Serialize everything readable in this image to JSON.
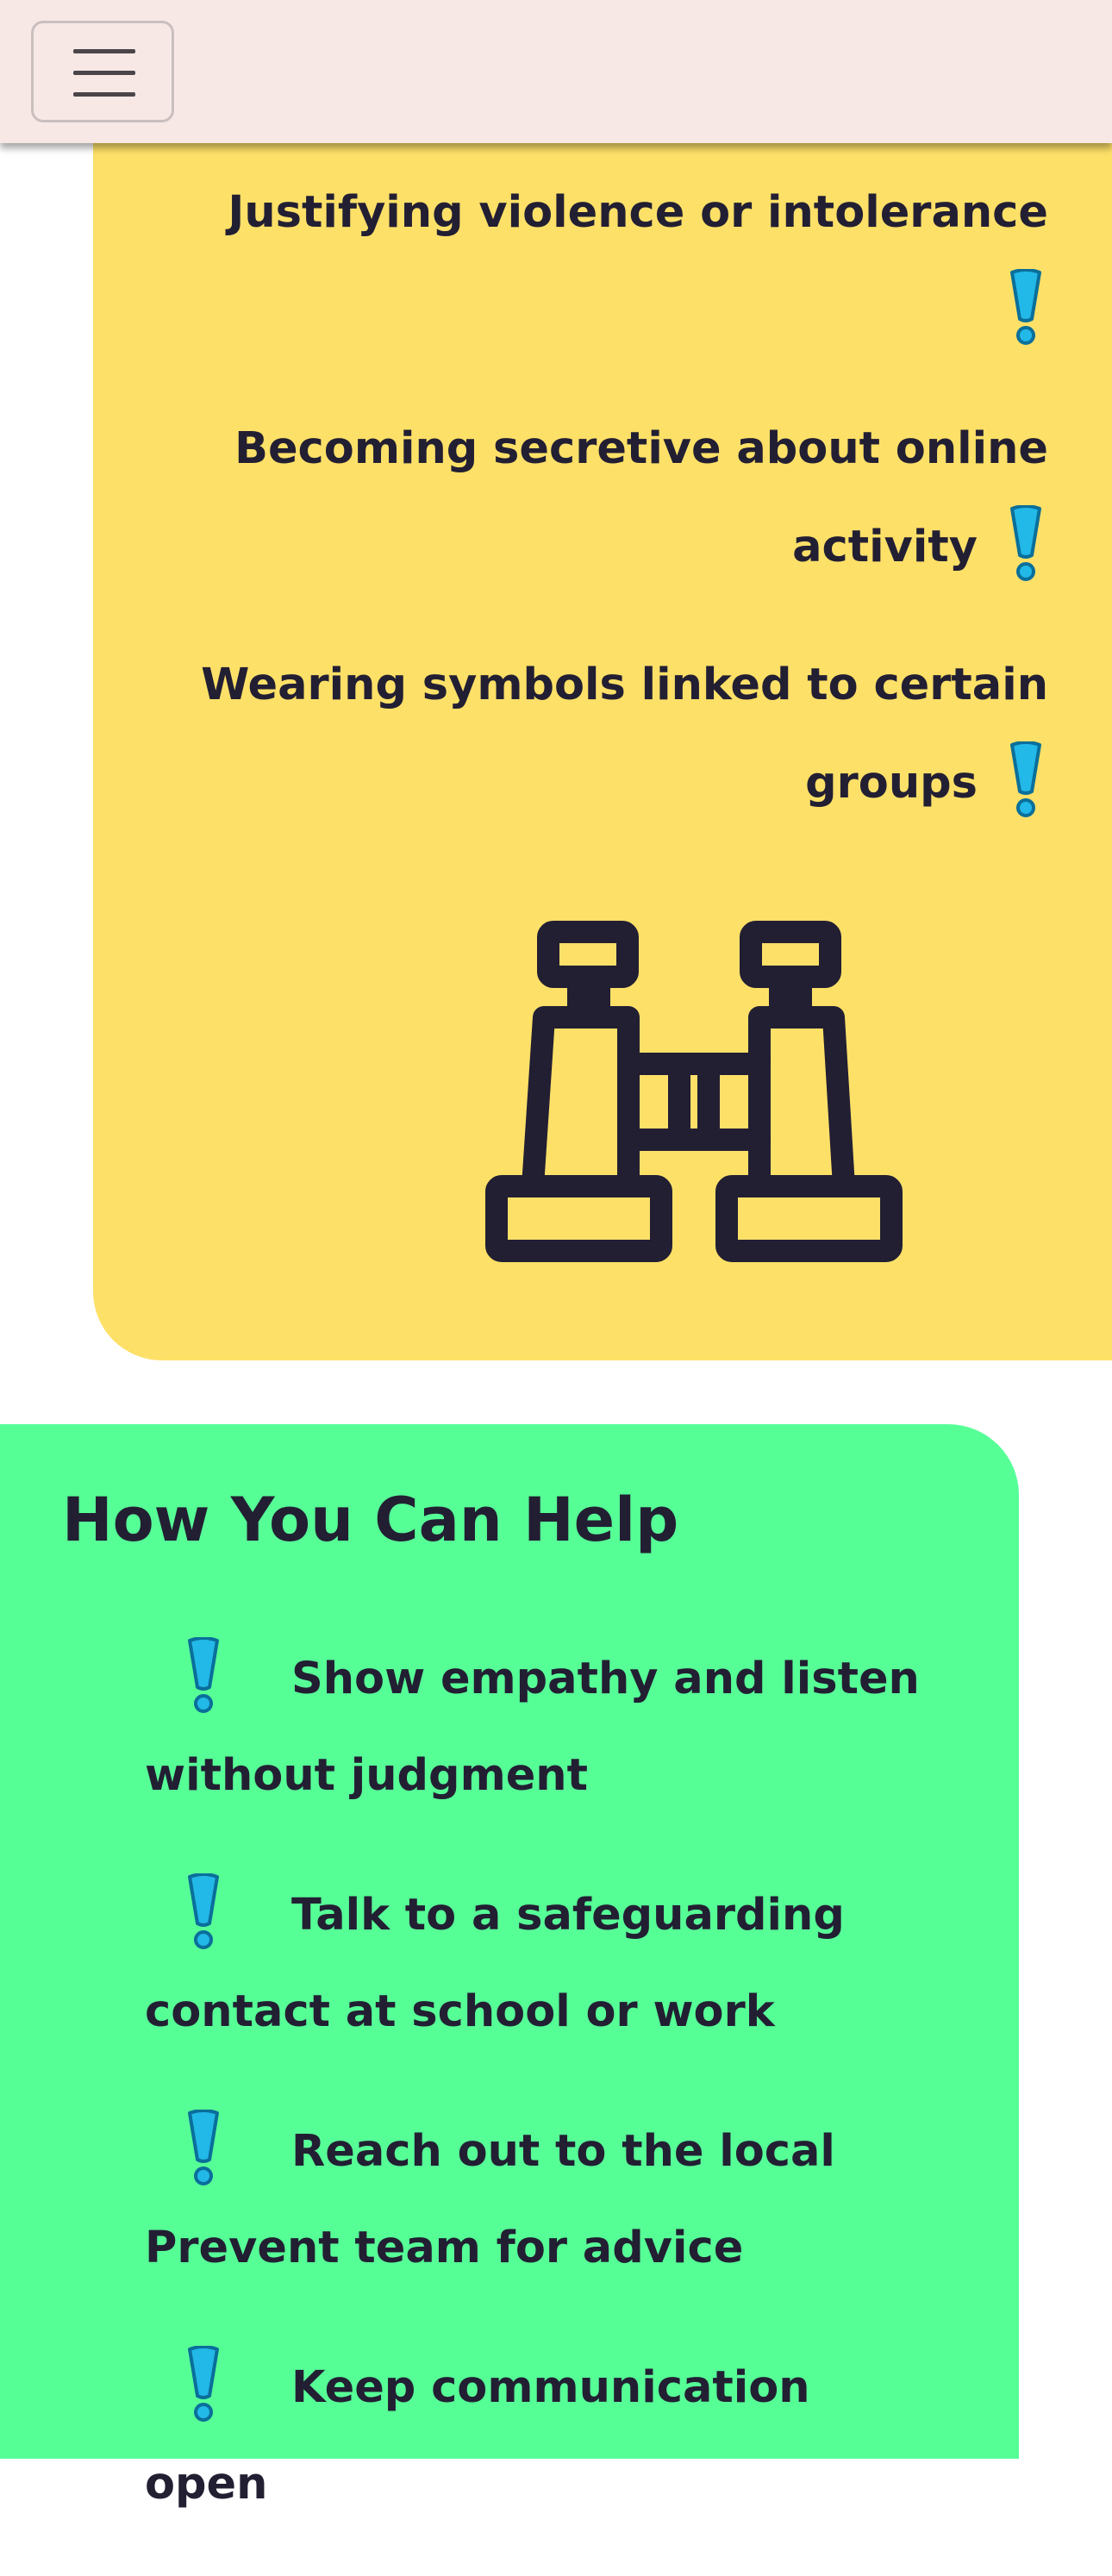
{
  "header": {
    "menu_icon": "hamburger-menu-icon"
  },
  "warning_signs": {
    "items": [
      "Justifying violence or intolerance",
      "Becoming secretive about online activity",
      "Wearing symbols linked to certain groups"
    ],
    "item_icon": "exclamation-icon",
    "illustration": "binoculars-icon",
    "background_color": "#fde068"
  },
  "help": {
    "title": "How You Can Help",
    "items": [
      "Show empathy and listen without judgment",
      "Talk to a safeguarding contact at school or work",
      "Reach out to the local Prevent team for advice",
      "Keep communication open"
    ],
    "item_icon": "exclamation-icon",
    "background_color": "#57ff97"
  },
  "colors": {
    "exclamation": "#1aa8d8",
    "text": "#221f33",
    "header_bg": "#f7e8e6"
  }
}
